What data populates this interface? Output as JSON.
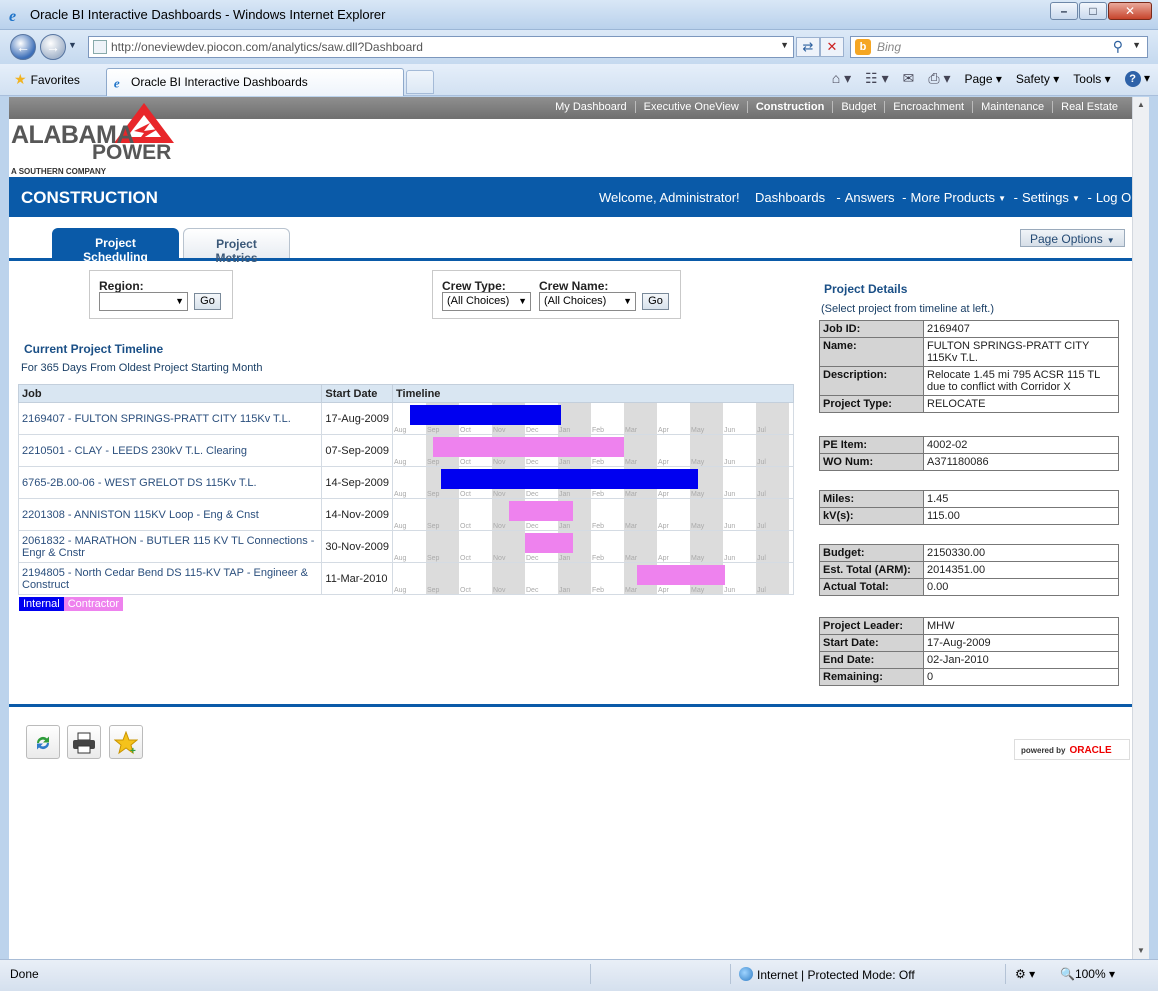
{
  "window": {
    "title": "Oracle BI Interactive Dashboards - Windows Internet Explorer",
    "minimize": "–",
    "maximize": "□",
    "close": "✕"
  },
  "browser": {
    "url": "http://oneviewdev.piocon.com/analytics/saw.dll?Dashboard",
    "search_placeholder": "Bing",
    "favorites_label": "Favorites",
    "tab_title": "Oracle BI Interactive Dashboards",
    "commands": [
      "Page",
      "Safety",
      "Tools"
    ],
    "status": "Done",
    "zone": "Internet | Protected Mode: Off",
    "zoom": "100%"
  },
  "topnav": {
    "items": [
      {
        "label": "My Dashboard",
        "active": false
      },
      {
        "label": "Executive OneView",
        "active": false
      },
      {
        "label": "Construction",
        "active": true
      },
      {
        "label": "Budget",
        "active": false
      },
      {
        "label": "Encroachment",
        "active": false
      },
      {
        "label": "Maintenance",
        "active": false
      },
      {
        "label": "Real Estate",
        "active": false
      }
    ]
  },
  "logo": {
    "line1": "ALABAMA",
    "line2": "POWER",
    "tagline": "A SOUTHERN COMPANY"
  },
  "header": {
    "title": "CONSTRUCTION",
    "welcome": "Welcome, Administrator!",
    "dashboards": "Dashboards",
    "answers": "Answers",
    "more_products": "More Products",
    "settings": "Settings",
    "logout": "Log Out"
  },
  "tabs": {
    "active": "Project Scheduling",
    "inactive": "Project Metrics",
    "page_options": "Page Options"
  },
  "prompts": {
    "region_label": "Region:",
    "region_value": "",
    "crew_type_label": "Crew Type:",
    "crew_type_value": "(All Choices)",
    "crew_name_label": "Crew Name:",
    "crew_name_value": "(All Choices)",
    "go": "Go"
  },
  "timeline": {
    "title": "Current Project Timeline",
    "subtitle": "For 365 Days From Oldest Project Starting Month",
    "headers": {
      "job": "Job",
      "start": "Start Date",
      "timeline": "Timeline"
    },
    "months": [
      "Aug",
      "Sep",
      "Oct",
      "Nov",
      "Dec",
      "Jan",
      "Feb",
      "Mar",
      "Apr",
      "May",
      "Jun",
      "Jul"
    ],
    "rows": [
      {
        "job": "2169407 - FULTON SPRINGS-PRATT CITY 115Kv T.L.",
        "start": "17-Aug-2009",
        "type": "internal",
        "start_month": 0.5,
        "end_month": 5.1
      },
      {
        "job": "2210501 - CLAY - LEEDS 230kV T.L. Clearing",
        "start": "07-Sep-2009",
        "type": "contractor",
        "start_month": 1.2,
        "end_month": 7.0
      },
      {
        "job": "6765-2B.00-06 - WEST GRELOT DS 115Kv T.L.",
        "start": "14-Sep-2009",
        "type": "internal",
        "start_month": 1.45,
        "end_month": 9.25
      },
      {
        "job": "2201308 - ANNISTON 115KV Loop - Eng & Cnst",
        "start": "14-Nov-2009",
        "type": "contractor",
        "start_month": 3.5,
        "end_month": 5.45
      },
      {
        "job": "2061832 - MARATHON - BUTLER 115 KV TL Connections - Engr & Cnstr",
        "start": "30-Nov-2009",
        "type": "contractor",
        "start_month": 4.0,
        "end_month": 5.45
      },
      {
        "job": "2194805 - North Cedar Bend DS 115-KV TAP - Engineer & Construct",
        "start": "11-Mar-2010",
        "type": "contractor",
        "start_month": 7.4,
        "end_month": 10.05
      }
    ],
    "legend": {
      "internal": "Internal",
      "contractor": "Contractor"
    }
  },
  "details": {
    "title": "Project Details",
    "subtitle": "(Select project from timeline at left.)",
    "groups": [
      [
        {
          "k": "Job ID:",
          "v": "2169407"
        },
        {
          "k": "Name:",
          "v": "FULTON SPRINGS-PRATT CITY 115Kv T.L."
        },
        {
          "k": "Description:",
          "v": "Relocate 1.45 mi 795 ACSR 115 TL due to conflict with Corridor X"
        },
        {
          "k": "Project Type:",
          "v": "RELOCATE"
        }
      ],
      [
        {
          "k": "PE Item:",
          "v": "4002-02"
        },
        {
          "k": "WO Num:",
          "v": "A371180086"
        }
      ],
      [
        {
          "k": "Miles:",
          "v": "1.45"
        },
        {
          "k": "kV(s):",
          "v": "115.00"
        }
      ],
      [
        {
          "k": "Budget:",
          "v": "2150330.00"
        },
        {
          "k": "Est. Total (ARM):",
          "v": "2014351.00"
        },
        {
          "k": "Actual Total:",
          "v": "0.00"
        }
      ],
      [
        {
          "k": "Project Leader:",
          "v": "MHW"
        },
        {
          "k": "Start Date:",
          "v": "17-Aug-2009"
        },
        {
          "k": "End Date:",
          "v": "02-Jan-2010"
        },
        {
          "k": "Remaining:",
          "v": "0"
        }
      ]
    ]
  },
  "footer": {
    "powered_by": "powered by",
    "oracle": "ORACLE"
  }
}
